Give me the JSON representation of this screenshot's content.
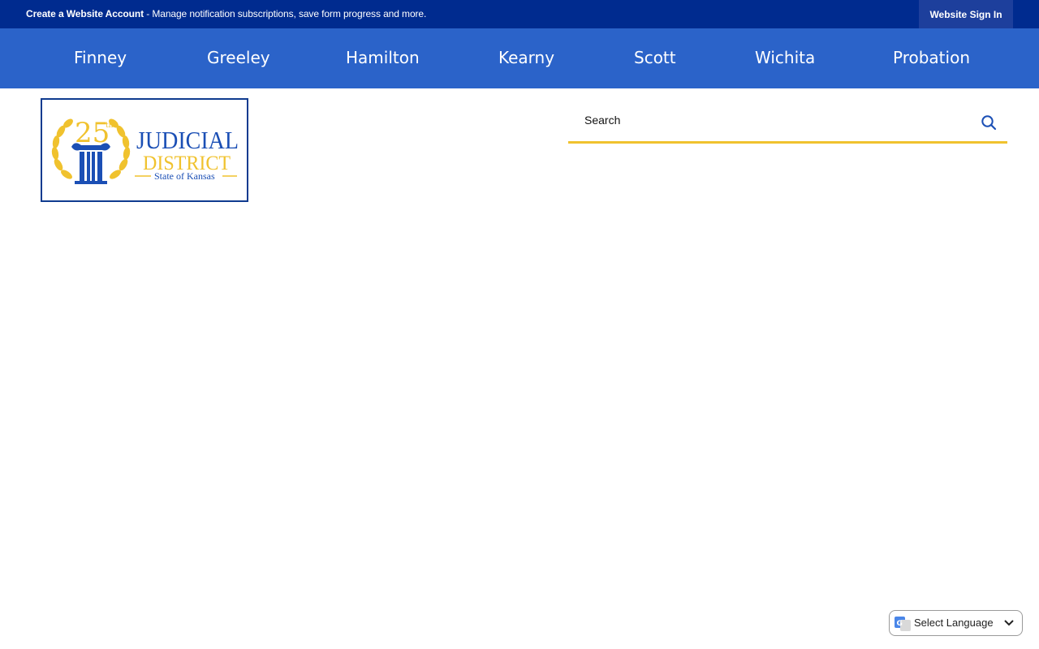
{
  "topbar": {
    "account_link_bold": "Create a Website Account",
    "account_link_rest": " - Manage notification subscriptions, save form progress and more.",
    "signin_label": "Website Sign In"
  },
  "nav": {
    "items": [
      {
        "label": "Finney"
      },
      {
        "label": "Greeley"
      },
      {
        "label": "Hamilton"
      },
      {
        "label": "Kearny"
      },
      {
        "label": "Scott"
      },
      {
        "label": "Wichita"
      },
      {
        "label": "Probation"
      }
    ]
  },
  "logo": {
    "number": "25",
    "ordinal": "th",
    "line1": "JUDICIAL",
    "line2": "DISTRICT",
    "line3": "State of Kansas"
  },
  "search": {
    "placeholder": "Search",
    "icon": "search-icon"
  },
  "language": {
    "label": "Select Language",
    "icon": "google-translate-icon"
  },
  "colors": {
    "topbar": "#002b8f",
    "nav": "#2b63c9",
    "accent_gold": "#f0c22e",
    "logo_blue": "#0f3b8f"
  }
}
